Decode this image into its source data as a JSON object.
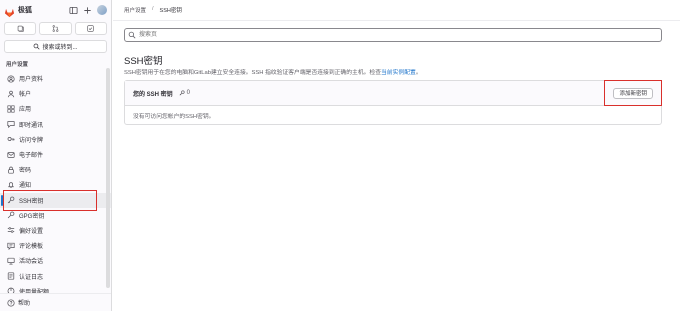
{
  "sidebar": {
    "brand": "极狐",
    "search_label": "搜索或转到...",
    "section_title": "用户设置",
    "items": [
      {
        "label": "用户资料",
        "icon": "profile-icon",
        "active": false
      },
      {
        "label": "帐户",
        "icon": "account-icon",
        "active": false
      },
      {
        "label": "应用",
        "icon": "applications-icon",
        "active": false
      },
      {
        "label": "即时通讯",
        "icon": "chat-icon",
        "active": false
      },
      {
        "label": "访问令牌",
        "icon": "token-icon",
        "active": false
      },
      {
        "label": "电子邮件",
        "icon": "email-icon",
        "active": false
      },
      {
        "label": "密码",
        "icon": "lock-icon",
        "active": false
      },
      {
        "label": "通知",
        "icon": "bell-icon",
        "active": false
      },
      {
        "label": "SSH密钥",
        "icon": "key-icon",
        "active": true
      },
      {
        "label": "GPG密钥",
        "icon": "gpg-key-icon",
        "active": false
      },
      {
        "label": "偏好设置",
        "icon": "preferences-icon",
        "active": false
      },
      {
        "label": "评论模板",
        "icon": "comment-template-icon",
        "active": false
      },
      {
        "label": "活动会话",
        "icon": "sessions-icon",
        "active": false
      },
      {
        "label": "认证日志",
        "icon": "log-icon",
        "active": false
      },
      {
        "label": "使用量配额",
        "icon": "quota-icon",
        "active": false
      }
    ],
    "help_label": "帮助"
  },
  "breadcrumb": [
    "用户设置",
    "SSH密钥"
  ],
  "search": {
    "placeholder": "搜索页"
  },
  "page": {
    "title": "SSH密钥",
    "description": "SSH密钥用于在您的电脑和GitLab建立安全连接。SSH 指纹验证客户端是否连接到正确的主机。检查",
    "description_link": "当前实例配置",
    "description_end": "。"
  },
  "keys_card": {
    "title": "您的 SSH 密钥",
    "count": "0",
    "add_button": "添加新密钥",
    "empty_text": "没有可访问您帐户的SSH密钥。"
  },
  "colors": {
    "accent": "#1f75cb",
    "highlight": "#d9302c",
    "brand": "#e24329"
  }
}
